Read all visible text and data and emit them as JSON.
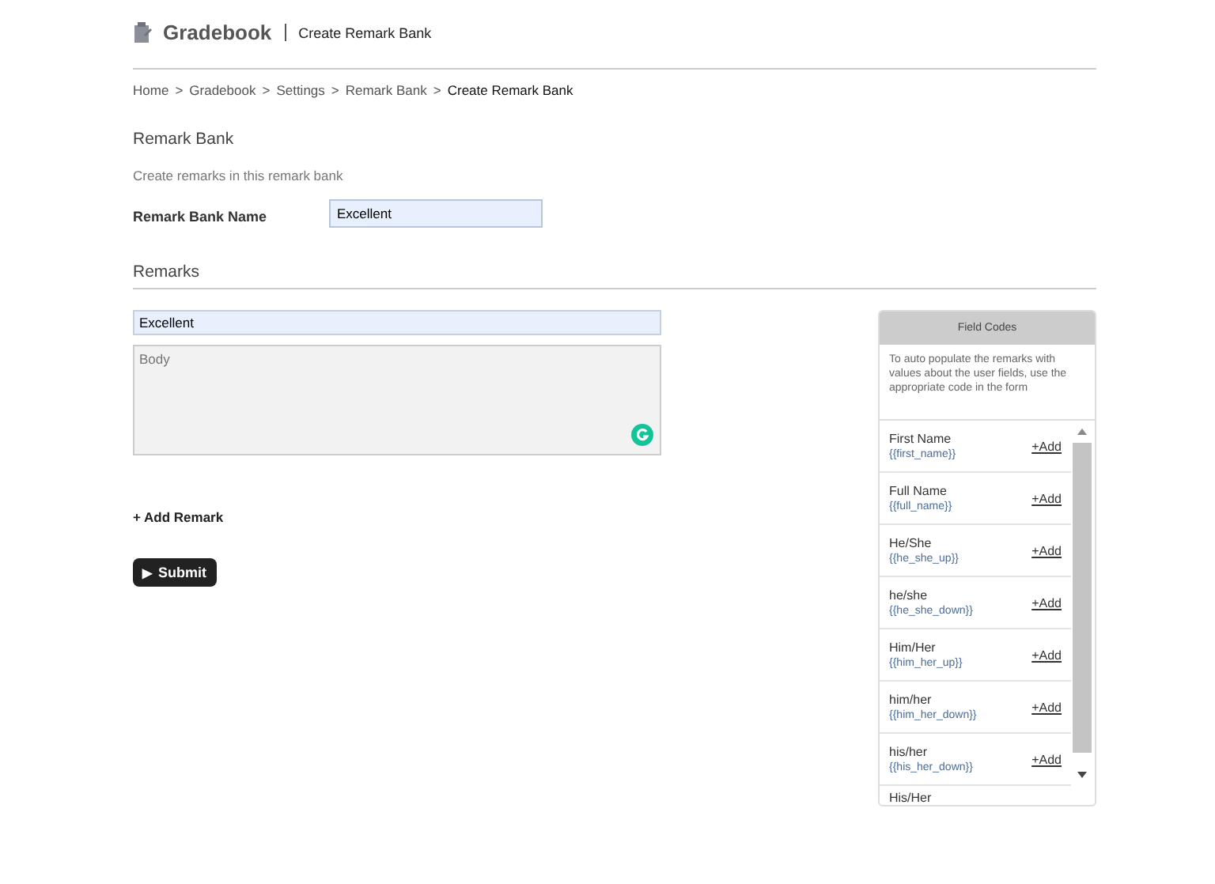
{
  "header": {
    "app_title": "Gradebook",
    "page_title": "Create Remark Bank"
  },
  "breadcrumb": [
    {
      "label": "Home",
      "current": false
    },
    {
      "label": "Gradebook",
      "current": false
    },
    {
      "label": "Settings",
      "current": false
    },
    {
      "label": "Remark Bank",
      "current": false
    },
    {
      "label": "Create Remark Bank",
      "current": true
    }
  ],
  "breadcrumb_separator": ">",
  "section": {
    "title": "Remark Bank",
    "description": "Create remarks in this remark bank"
  },
  "name_field": {
    "label": "Remark Bank Name",
    "value": "Excellent"
  },
  "remarks": {
    "title": "Remarks",
    "items": [
      {
        "title": "Excellent",
        "body_placeholder": "Body"
      }
    ],
    "add_label": "+ Add Remark"
  },
  "submit": {
    "icon": "▶",
    "label": "Submit"
  },
  "field_codes": {
    "title": "Field Codes",
    "description": "To auto populate the remarks with values about the user fields, use the appropriate code in the form",
    "items": [
      {
        "name": "First Name",
        "code": "{{first_name}}",
        "add_label": "+Add"
      },
      {
        "name": "Full Name",
        "code": "{{full_name}}",
        "add_label": "+Add"
      },
      {
        "name": "He/She",
        "code": "{{he_she_up}}",
        "add_label": "+Add"
      },
      {
        "name": "he/she",
        "code": "{{he_she_down}}",
        "add_label": "+Add"
      },
      {
        "name": "Him/Her",
        "code": "{{him_her_up}}",
        "add_label": "+Add"
      },
      {
        "name": "him/her",
        "code": "{{him_her_down}}",
        "add_label": "+Add"
      },
      {
        "name": "his/her",
        "code": "{{his_her_down}}",
        "add_label": "+Add"
      },
      {
        "name": "His/Her"
      }
    ]
  }
}
